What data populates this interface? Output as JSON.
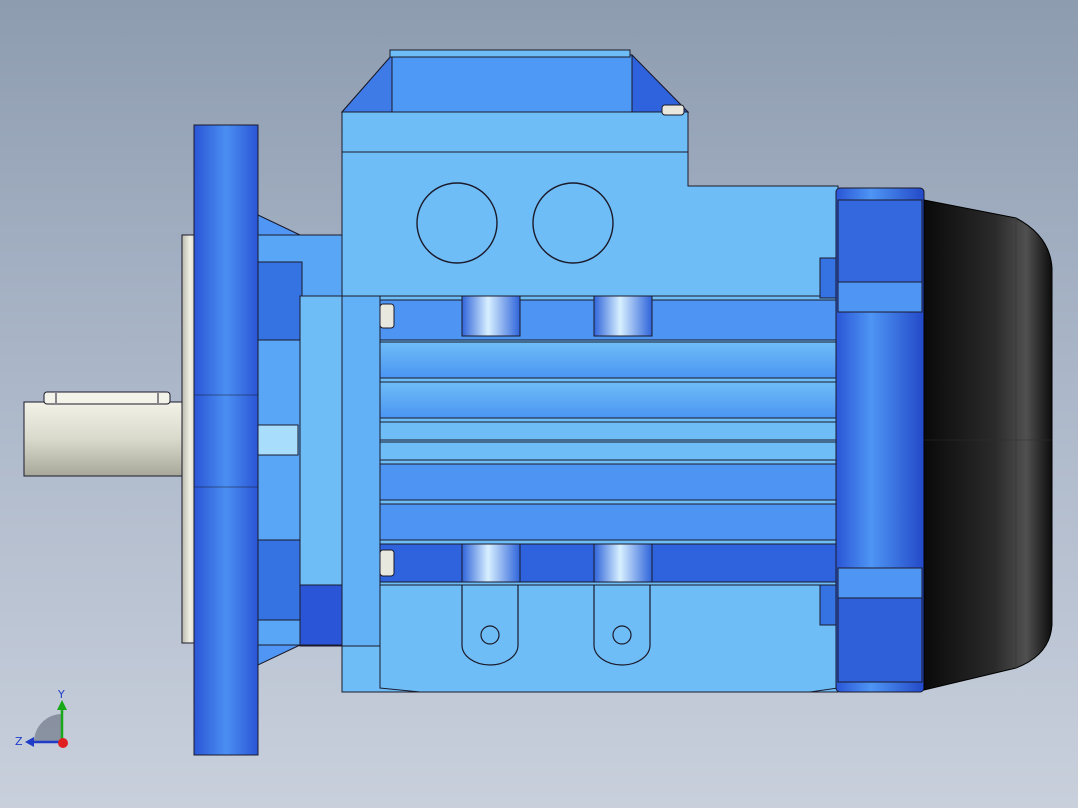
{
  "viewport": {
    "background_top": "#8e9cb0",
    "background_bottom": "#c9d0dc",
    "model": "electric-motor-side-view"
  },
  "colors": {
    "body_light": "#6fbdf7",
    "body_mid": "#4b8ff2",
    "body_dark": "#2a55d6",
    "shaft": "#e6e6da",
    "fan_cover": "#111111",
    "edge": "#1a1a2a"
  },
  "triad": {
    "y_label": "Y",
    "z_label": "Z",
    "x_marker_color": "#e02020",
    "y_axis_color": "#18a818",
    "z_axis_color": "#1e3cc8"
  }
}
